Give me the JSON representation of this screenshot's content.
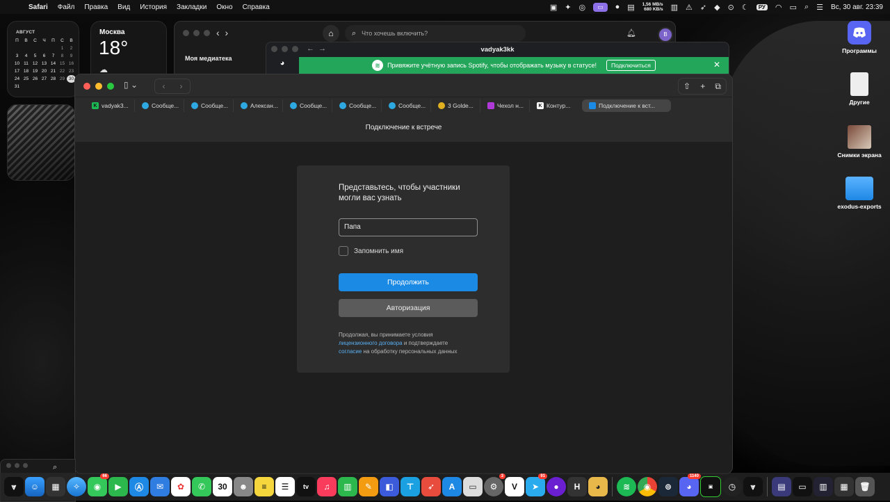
{
  "menubar": {
    "items": [
      "Safari",
      "Файл",
      "Правка",
      "Вид",
      "История",
      "Закладки",
      "Окно",
      "Справка"
    ],
    "net_up": "1,56 MB/s",
    "net_down": "680 KB/s",
    "input_lang": "РУ",
    "datetime": "Вс, 30 авг.  23:39"
  },
  "calendar": {
    "month": "АВГУСТ",
    "weekdays": [
      "П",
      "В",
      "С",
      "Ч",
      "П",
      "С",
      "В"
    ],
    "weeks": [
      [
        "",
        "",
        "",
        "",
        "",
        "1",
        "2"
      ],
      [
        "3",
        "4",
        "5",
        "6",
        "7",
        "8",
        "9"
      ],
      [
        "10",
        "11",
        "12",
        "13",
        "14",
        "15",
        "16"
      ],
      [
        "17",
        "18",
        "19",
        "20",
        "21",
        "22",
        "23"
      ],
      [
        "24",
        "25",
        "26",
        "27",
        "28",
        "29",
        "30"
      ],
      [
        "31",
        "",
        "",
        "",
        "",
        "",
        ""
      ]
    ],
    "today": "30"
  },
  "weather": {
    "city": "Москва",
    "temp": "18°"
  },
  "desktop_icons": [
    {
      "label": "Программы",
      "icon": "discord-icon"
    },
    {
      "label": "Другие",
      "icon": "document-icon"
    },
    {
      "label": "Снимки экрана",
      "icon": "screenshot-stack-icon"
    },
    {
      "label": "exodus-exports",
      "icon": "folder-icon"
    }
  ],
  "spotify": {
    "search_placeholder": "Что хочешь включить?",
    "library": "Моя медиатека",
    "avatar": "B"
  },
  "discord": {
    "title": "vadyak3kk",
    "banner_text": "Привяжите учётную запись Spotify, чтобы отображать музыку в статусе!",
    "banner_button": "Подключиться"
  },
  "safari": {
    "tabs": [
      {
        "label": "vadyak3...",
        "fav_color": "#1db954",
        "fav_text": "K"
      },
      {
        "label": "Сообще...",
        "fav_color": "#2ea8e0",
        "fav_text": ""
      },
      {
        "label": "Сообще...",
        "fav_color": "#2ea8e0",
        "fav_text": ""
      },
      {
        "label": "Алексан...",
        "fav_color": "#2ea8e0",
        "fav_text": ""
      },
      {
        "label": "Сообще...",
        "fav_color": "#2ea8e0",
        "fav_text": ""
      },
      {
        "label": "Сообще...",
        "fav_color": "#2ea8e0",
        "fav_text": ""
      },
      {
        "label": "Сообще...",
        "fav_color": "#2ea8e0",
        "fav_text": ""
      },
      {
        "label": "3 Golde...",
        "fav_color": "#e0b020",
        "fav_text": ""
      },
      {
        "label": "Чехол н...",
        "fav_color": "#b03ad8",
        "fav_text": ""
      },
      {
        "label": "Контур...",
        "fav_color": "#ffffff",
        "fav_text": "K"
      }
    ],
    "active_tab": "Подключение к вст...",
    "page_title": "Подключение к встрече"
  },
  "join_form": {
    "heading": "Представьтесь, чтобы участники могли вас узнать",
    "name_value": "Папа",
    "remember_label": "Запомнить имя",
    "continue_label": "Продолжить",
    "login_label": "Авторизация",
    "legal_prefix": "Продолжая, вы принимаете условия",
    "legal_link1": "лицензионного договора",
    "legal_middle": "и подтверждаете",
    "legal_link2": "согласие",
    "legal_suffix": "на обработку персональных данных"
  },
  "dock": {
    "tv_label": "tv",
    "calendar_day": "30",
    "badges": {
      "messages": "66",
      "settings": "3",
      "telegram": "91",
      "discord": "1140"
    }
  },
  "colors": {
    "primary_button": "#1a8ae5",
    "banner_green": "#23a55a",
    "link": "#5ab0f2"
  }
}
